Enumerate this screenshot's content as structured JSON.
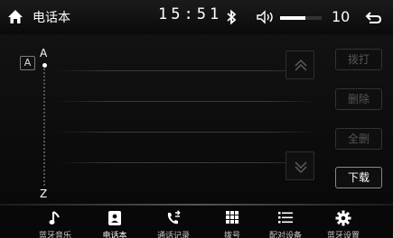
{
  "status_bar": {
    "title": "电话本",
    "time": "15:51",
    "volume": 10,
    "volume_level": 0.6
  },
  "phonebook": {
    "current_letter": "A",
    "index_start": "A",
    "index_end": "Z"
  },
  "actions": {
    "dial": "拨打",
    "delete": "删除",
    "delete_all": "全删",
    "download": "下载"
  },
  "nav": {
    "items": [
      {
        "label": "蓝牙音乐",
        "icon": "music-note-icon"
      },
      {
        "label": "电话本",
        "icon": "phonebook-icon"
      },
      {
        "label": "通话记录",
        "icon": "call-log-icon"
      },
      {
        "label": "拨号",
        "icon": "dialpad-icon"
      },
      {
        "label": "配对设备",
        "icon": "paired-devices-icon"
      },
      {
        "label": "蓝牙设置",
        "icon": "settings-gear-icon"
      }
    ]
  }
}
